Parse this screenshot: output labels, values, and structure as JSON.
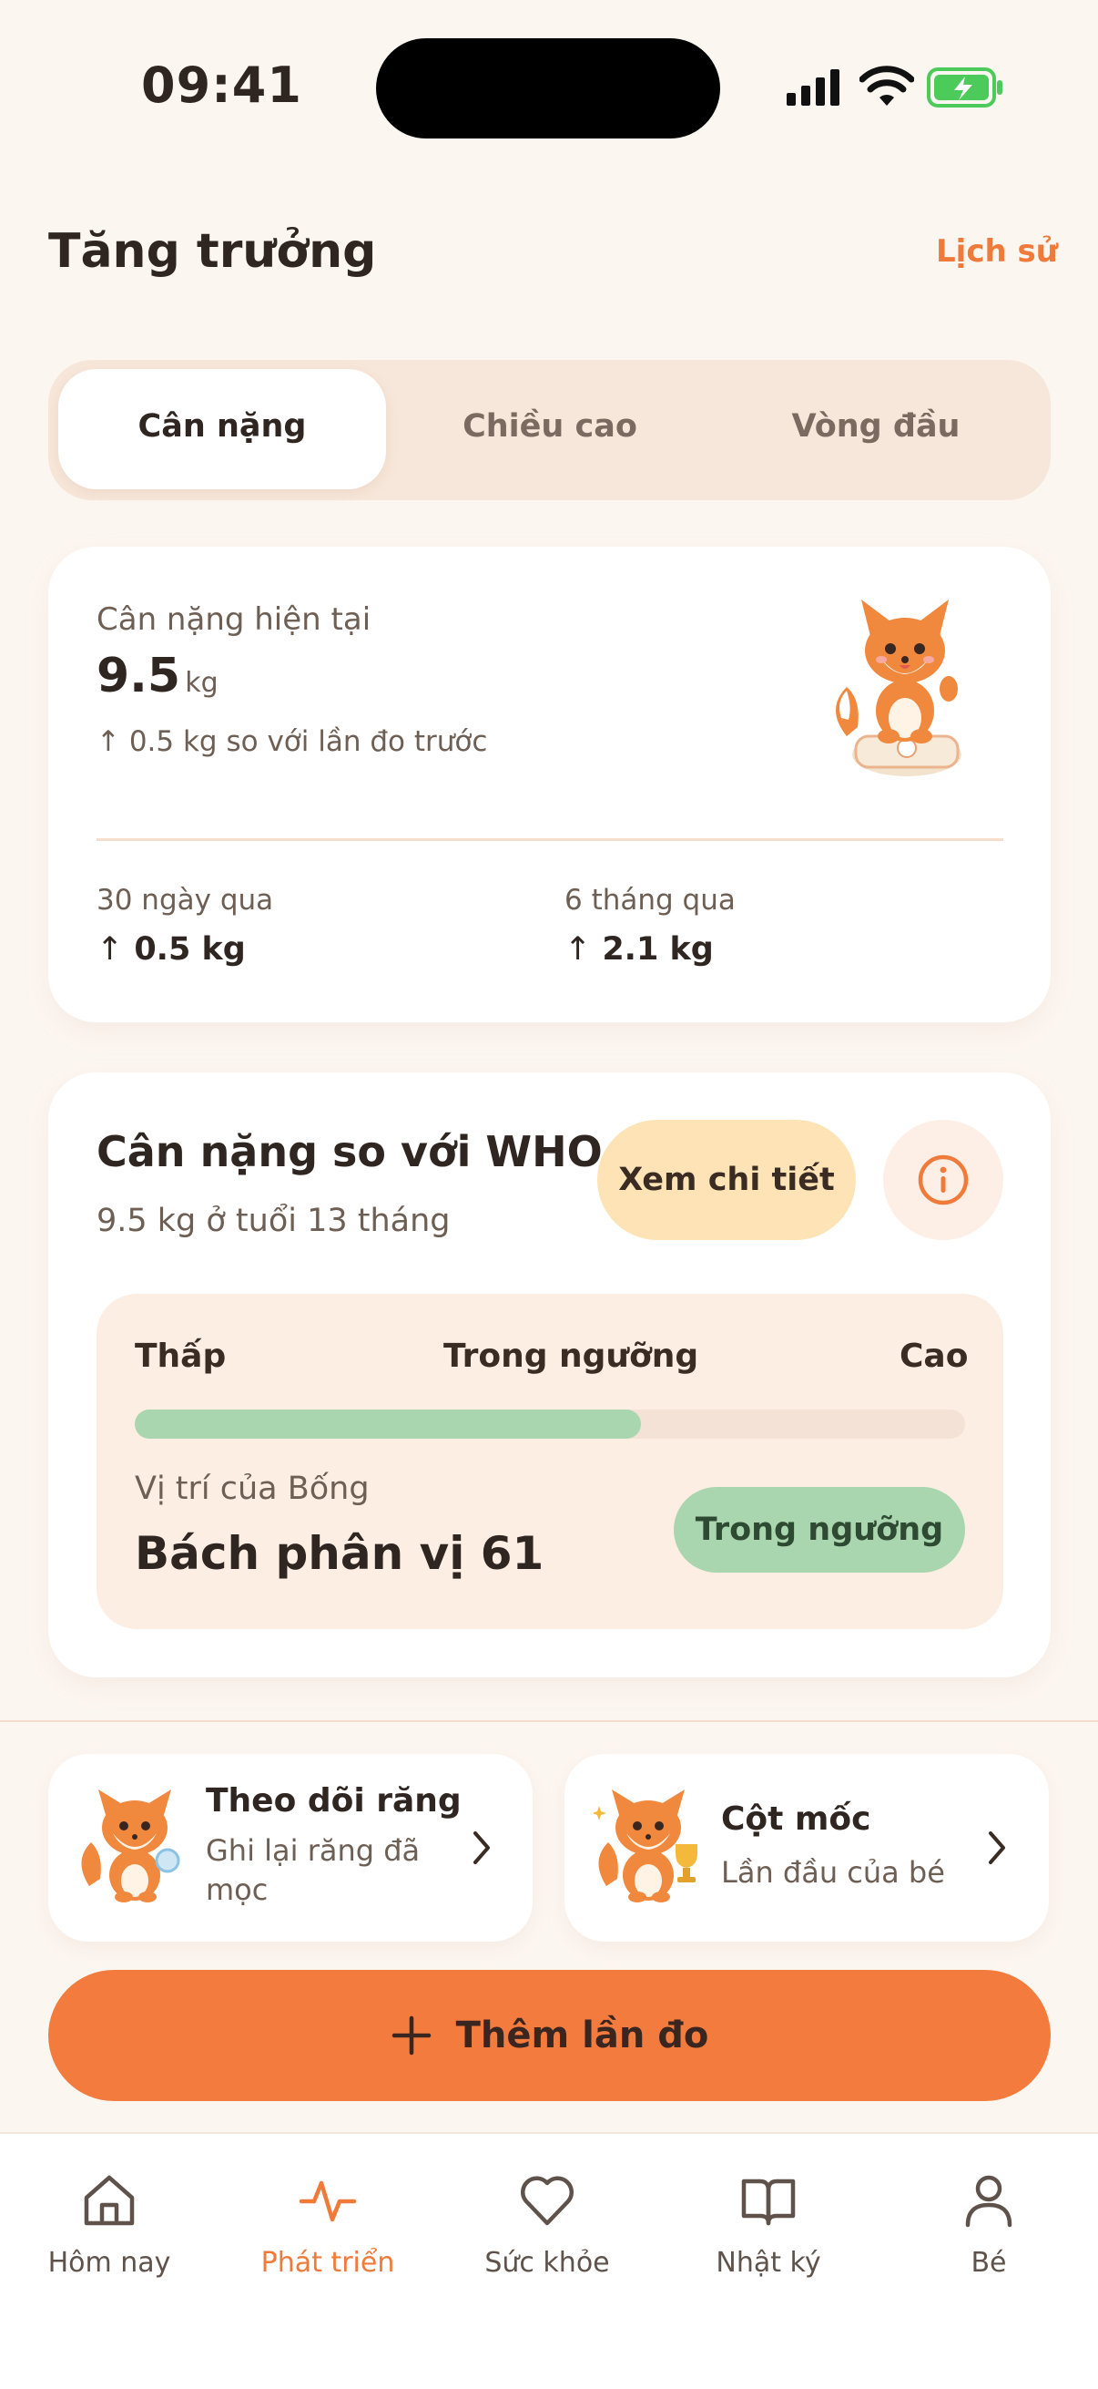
{
  "status_bar": {
    "time": "09:41"
  },
  "header": {
    "title": "Tăng trưởng",
    "history_link": "Lịch sử"
  },
  "tabs": [
    {
      "label": "Cân nặng",
      "active": true
    },
    {
      "label": "Chiều cao",
      "active": false
    },
    {
      "label": "Vòng đầu",
      "active": false
    }
  ],
  "current": {
    "label": "Cân nặng hiện tại",
    "value": "9.5",
    "unit": "kg",
    "change_note": "↑ 0.5 kg so với lần đo trước",
    "stats": [
      {
        "period": "30 ngày qua",
        "arrow": "↑",
        "value": "0.5 kg"
      },
      {
        "period": "6 tháng qua",
        "arrow": "↑",
        "value": "2.1 kg"
      }
    ]
  },
  "who": {
    "title": "Cân nặng so với WHO",
    "subtitle": "9.5 kg ở tuổi 13 tháng",
    "detail_button": "Xem chi tiết",
    "range_labels": {
      "low": "Thấp",
      "mid": "Trong ngưỡng",
      "high": "Cao"
    },
    "progress_fraction": 0.61,
    "position_label": "Vị trí của Bống",
    "position_value": "Bách phân vị 61",
    "status": "Trong ngưỡng"
  },
  "shortcuts": [
    {
      "title": "Theo dõi răng",
      "subtitle": "Ghi lại răng đã mọc"
    },
    {
      "title": "Cột mốc",
      "subtitle": "Lần đầu của bé"
    }
  ],
  "add_button": "Thêm lần đo",
  "nav": [
    {
      "label": "Hôm nay",
      "icon": "home-icon",
      "active": false
    },
    {
      "label": "Phát triển",
      "icon": "activity-icon",
      "active": true
    },
    {
      "label": "Sức khỏe",
      "icon": "heart-icon",
      "active": false
    },
    {
      "label": "Nhật ký",
      "icon": "book-icon",
      "active": false
    },
    {
      "label": "Bé",
      "icon": "user-icon",
      "active": false
    }
  ],
  "colors": {
    "accent": "#F37B3D",
    "background": "#FCF6F1",
    "success": "#A9D6AE",
    "warm_button": "#FDE3B6"
  }
}
